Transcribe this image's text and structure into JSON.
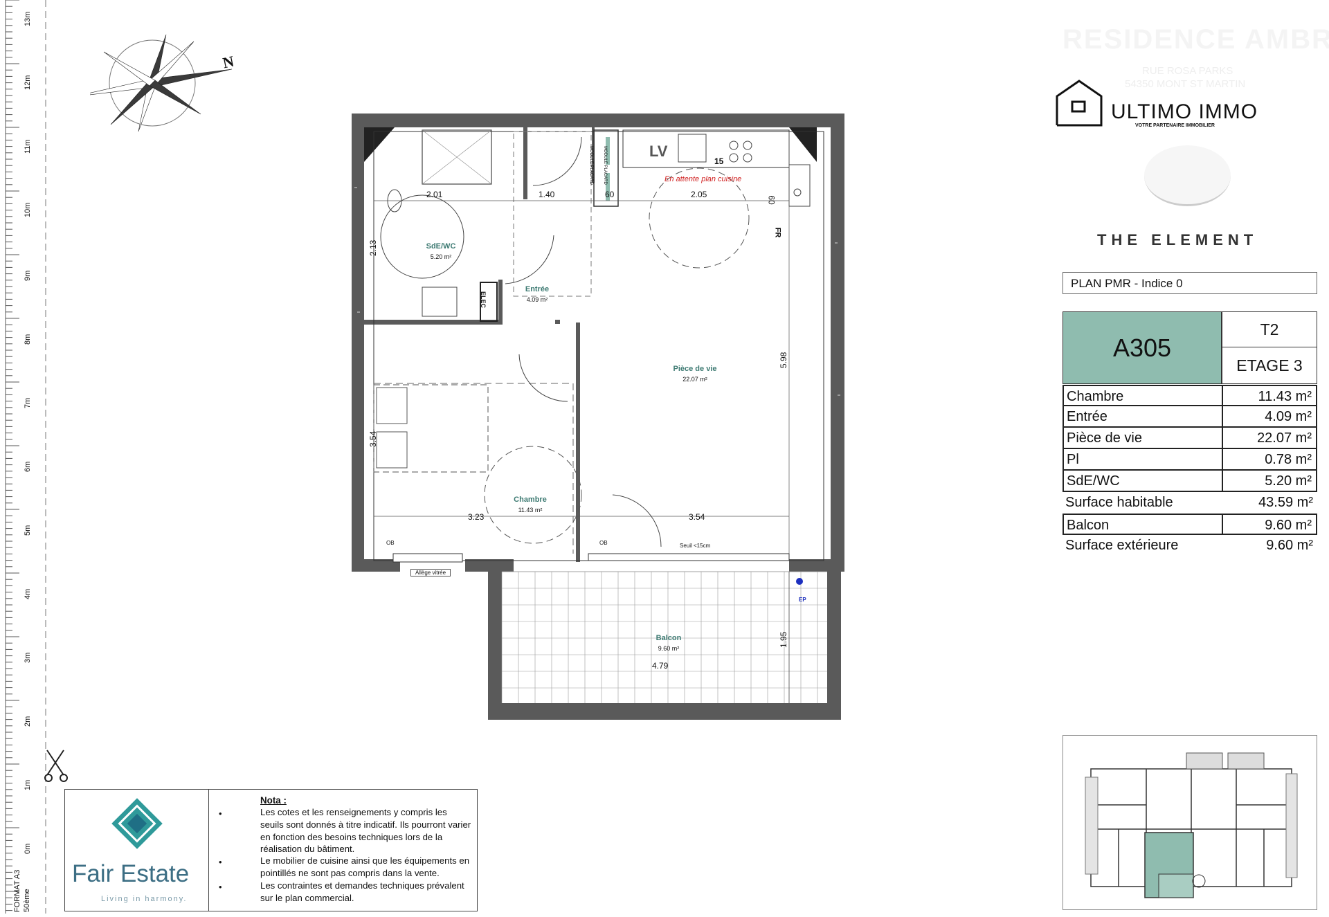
{
  "ruler": {
    "labels": [
      "13m",
      "12m",
      "11m",
      "10m",
      "9m",
      "8m",
      "7m",
      "6m",
      "5m",
      "4m",
      "3m",
      "2m",
      "1m",
      "0m"
    ]
  },
  "compass": {
    "north_label": "N"
  },
  "plan": {
    "rooms": {
      "sde": {
        "name": "SdE/WC",
        "area": "5.20 m²"
      },
      "entree": {
        "name": "Entrée",
        "area": "4.09 m²"
      },
      "piece": {
        "name": "Pièce de vie",
        "area": "22.07 m²"
      },
      "chambre": {
        "name": "Chambre",
        "area": "11.43 m²"
      },
      "balcon": {
        "name": "Balcon",
        "area": "9.60 m²"
      }
    },
    "dimensions": {
      "d1": "2.01",
      "d2": "1.40",
      "d3": "60",
      "d4": "2.05",
      "d5": "60",
      "d6": "2.13",
      "d7": "5.98",
      "d8": "3.54",
      "d9": "3.23",
      "d10": "3.54",
      "d11": "1.95",
      "d12": "4.79"
    },
    "annotations": {
      "kitchen_note": "En attente plan cuisine",
      "lv": "LV",
      "fifteen": "15",
      "fr": "FR",
      "elec": "ELEC",
      "module1": "MODULE PLACARD",
      "module2": "MODULE PLACARD",
      "allege": "Allège vitrée",
      "seuil": "Seuil <15cm",
      "ob1": "OB",
      "ob2": "OB",
      "ep": "EP"
    }
  },
  "brand": {
    "ultimo_name": "ULTIMO IMMO",
    "ultimo_tagline": "VOTRE PARTENAIRE IMMOBILIER",
    "ghost_title": "RESIDENCE AMBRE",
    "ghost_addr1": "RUE ROSA PARKS",
    "ghost_addr2": "54350 MONT ST MARTIN",
    "program": "THE ELEMENT"
  },
  "plan_label": "PLAN PMR - Indice 0",
  "lot": {
    "id": "A305",
    "type": "T2",
    "floor": "ETAGE 3"
  },
  "surfaces": [
    {
      "name": "Chambre",
      "value": "11.43 m²",
      "boxed": true
    },
    {
      "name": "Entrée",
      "value": "4.09 m²",
      "boxed": true
    },
    {
      "name": "Pièce de vie",
      "value": "22.07 m²",
      "boxed": true
    },
    {
      "name": "Pl",
      "value": "0.78 m²",
      "boxed": true
    },
    {
      "name": "SdE/WC",
      "value": "5.20 m²",
      "boxed": true
    },
    {
      "name": "Surface habitable",
      "value": "43.59 m²",
      "boxed": false
    },
    {
      "name": "Balcon",
      "value": "9.60 m²",
      "boxed": true
    },
    {
      "name": "Surface extérieure",
      "value": "9.60 m²",
      "boxed": false
    }
  ],
  "footer": {
    "company": "Fair Estate",
    "tagline": "Living in harmony.",
    "nota_title": "Nota :",
    "note1": "Les cotes et les renseignements y compris les seuils sont donnés à titre indicatif. Ils pourront varier en fonction des besoins techniques lors de la réalisation du bâtiment.",
    "note2": "Le mobilier de cuisine ainsi que les équipements en pointillés ne sont pas compris dans la vente.",
    "note3": "Les contraintes et demandes techniques prévalent sur le plan commercial.",
    "format_line1": "FORMAT A3",
    "format_line2": "50ème"
  },
  "colors": {
    "accent": "#8fbcaf",
    "room_label": "#3d7a72",
    "wall": "#5a5a5a",
    "kitchen_note": "#d02020",
    "logo_teal": "#3c8a8a"
  }
}
